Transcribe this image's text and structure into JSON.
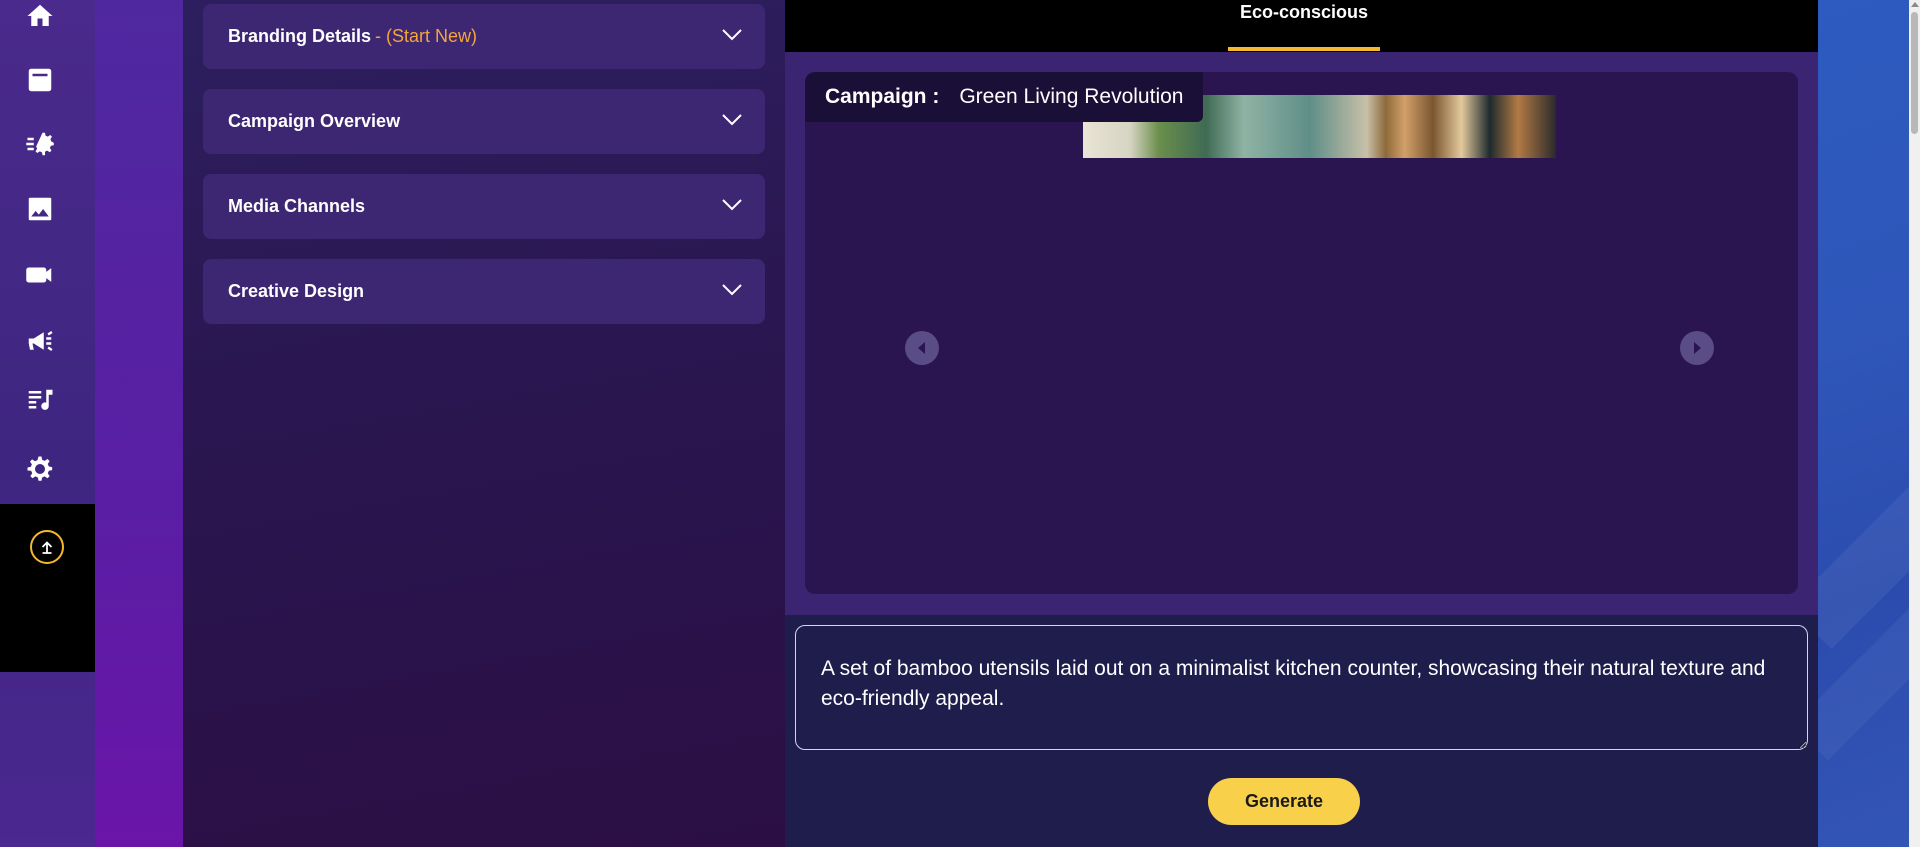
{
  "sidebar": {
    "icons": [
      {
        "name": "home-icon"
      },
      {
        "name": "campaigns-icon"
      },
      {
        "name": "automation-icon"
      },
      {
        "name": "image-icon"
      },
      {
        "name": "video-icon"
      },
      {
        "name": "megaphone-icon"
      },
      {
        "name": "content-icon"
      },
      {
        "name": "settings-icon"
      },
      {
        "name": "upload-icon"
      }
    ]
  },
  "accordion": {
    "branding": {
      "title": "Branding Details",
      "subtitle": "- (Start New)"
    },
    "campaign_overview": {
      "title": "Campaign Overview"
    },
    "media_channels": {
      "title": "Media Channels"
    },
    "creative_design": {
      "title": "Creative Design"
    }
  },
  "main": {
    "active_tab": "Eco-conscious",
    "campaign_label": "Campaign :",
    "campaign_name": "Green Living Revolution",
    "prompt_text": "A set of bamboo utensils laid out on a minimalist kitchen counter, showcasing their natural texture and eco-friendly appeal.",
    "generate_label": "Generate"
  },
  "colors": {
    "accent": "#f5b82e",
    "button": "#f8d04a",
    "subtitle": "#f4a63a",
    "panel": "#3d2672"
  }
}
